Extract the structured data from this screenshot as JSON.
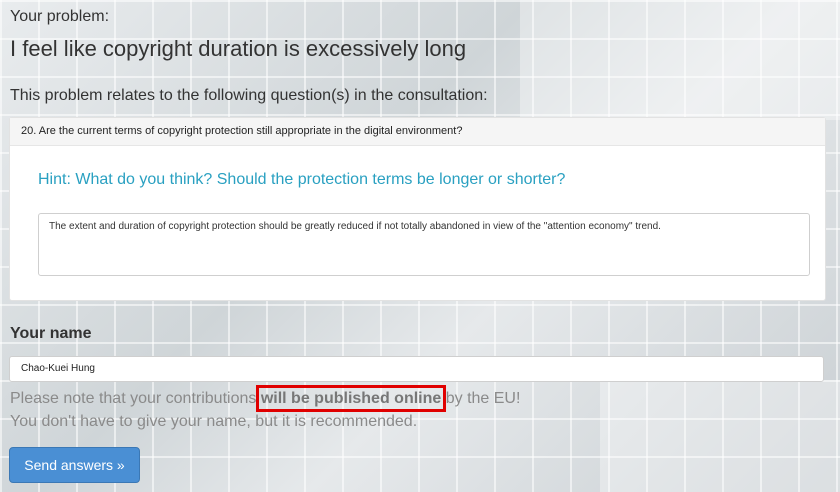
{
  "problem": {
    "caption": "Your problem:",
    "title": "I feel like copyright duration is excessively long",
    "relates_text": "This problem relates to the following question(s) in the consultation:"
  },
  "question": {
    "heading": "20. Are the current terms of copyright protection still appropriate in the digital environment?",
    "hint": "Hint: What do you think? Should the protection terms be longer or shorter?",
    "answer": "The extent and duration of copyright protection should be greatly reduced if not totally abandoned in view of the \"attention economy\" trend."
  },
  "name_section": {
    "label": "Your name",
    "value": "Chao-Kuei Hung"
  },
  "notes": {
    "line1_before": "Please note that your contributions ",
    "line1_bold": "will be published online",
    "line1_after": " by the EU!",
    "line2": "You don't have to give your name, but it is recommended."
  },
  "send_button": {
    "label": "Send answers »"
  }
}
